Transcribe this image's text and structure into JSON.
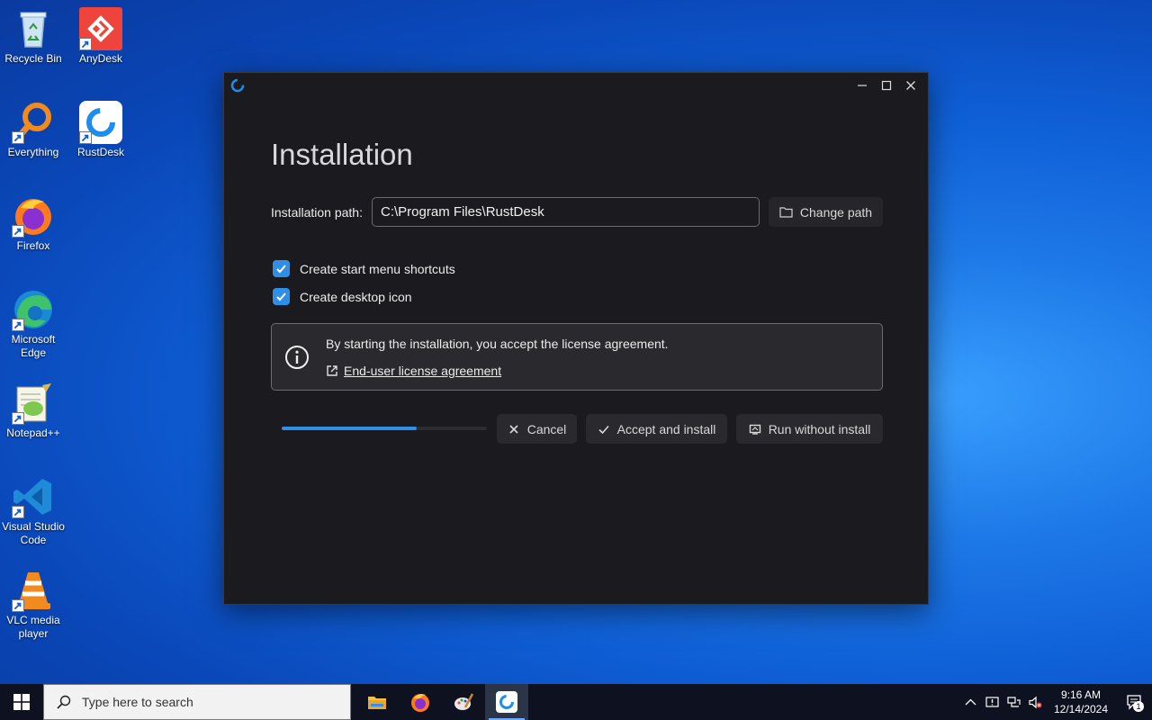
{
  "desktop": {
    "icons": [
      {
        "label": "Recycle Bin"
      },
      {
        "label": "AnyDesk"
      },
      {
        "label": "Everything"
      },
      {
        "label": "RustDesk"
      },
      {
        "label": "Firefox"
      },
      {
        "label": "Microsoft Edge"
      },
      {
        "label": "Notepad++"
      },
      {
        "label": "Visual Studio Code"
      },
      {
        "label": "VLC media player"
      }
    ]
  },
  "window": {
    "title": "Installation",
    "path_label": "Installation path:",
    "path_value": "C:\\Program Files\\RustDesk",
    "change_path_label": "Change path",
    "checkboxes": [
      {
        "label": "Create start menu shortcuts",
        "checked": true
      },
      {
        "label": "Create desktop icon",
        "checked": true
      }
    ],
    "license_text": "By starting the installation, you accept the license agreement.",
    "license_link": "End-user license agreement",
    "progress_percent": 66,
    "cancel_label": "Cancel",
    "accept_label": "Accept and install",
    "run_label": "Run without install",
    "accent_color": "#2f8ee8"
  },
  "taskbar": {
    "search_placeholder": "Type here to search",
    "apps": [
      "file-explorer-icon",
      "firefox-icon",
      "paint-icon",
      "rustdesk-icon"
    ],
    "time": "9:16 AM",
    "date": "12/14/2024",
    "notification_count": "1"
  }
}
